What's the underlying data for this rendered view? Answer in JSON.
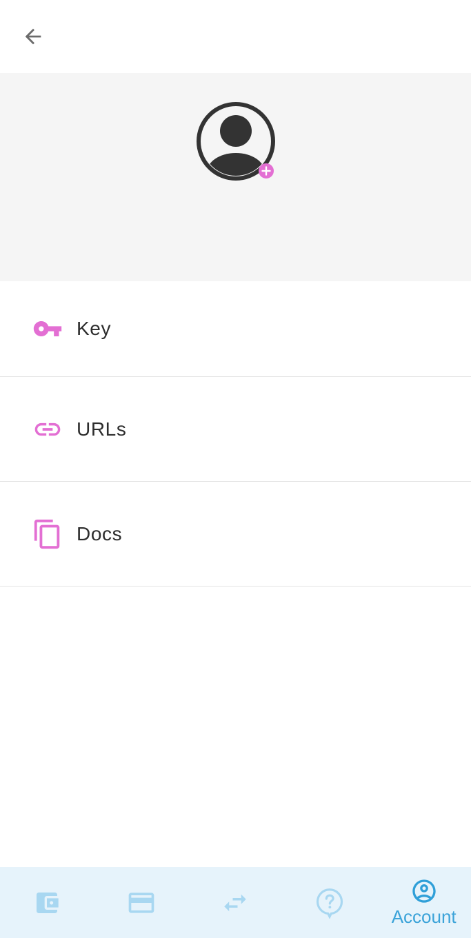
{
  "colors": {
    "accent_pink": "#e36fd3",
    "nav_active": "#2f9fd8",
    "nav_inactive": "#a8d7f1",
    "header_bg": "#f5f5f5",
    "nav_bg": "#e6f3fb",
    "text": "#2d2d2d",
    "icon_dark": "#333333"
  },
  "topbar": {
    "back_icon": "arrow-left-icon"
  },
  "profile": {
    "avatar_icon": "account-circle-icon",
    "add_badge_icon": "plus-circle-icon"
  },
  "menu": [
    {
      "label": "Key",
      "icon": "key-icon"
    },
    {
      "label": "URLs",
      "icon": "link-icon"
    },
    {
      "label": "Docs",
      "icon": "copy-icon"
    }
  ],
  "bottom_nav": {
    "items": [
      {
        "icon": "wallet-icon",
        "active": false
      },
      {
        "icon": "credit-card-icon",
        "active": false
      },
      {
        "icon": "swap-horizontal-icon",
        "active": false
      },
      {
        "icon": "help-bubble-icon",
        "active": false
      },
      {
        "icon": "account-circle-icon",
        "active": true,
        "label": "Account"
      }
    ]
  }
}
